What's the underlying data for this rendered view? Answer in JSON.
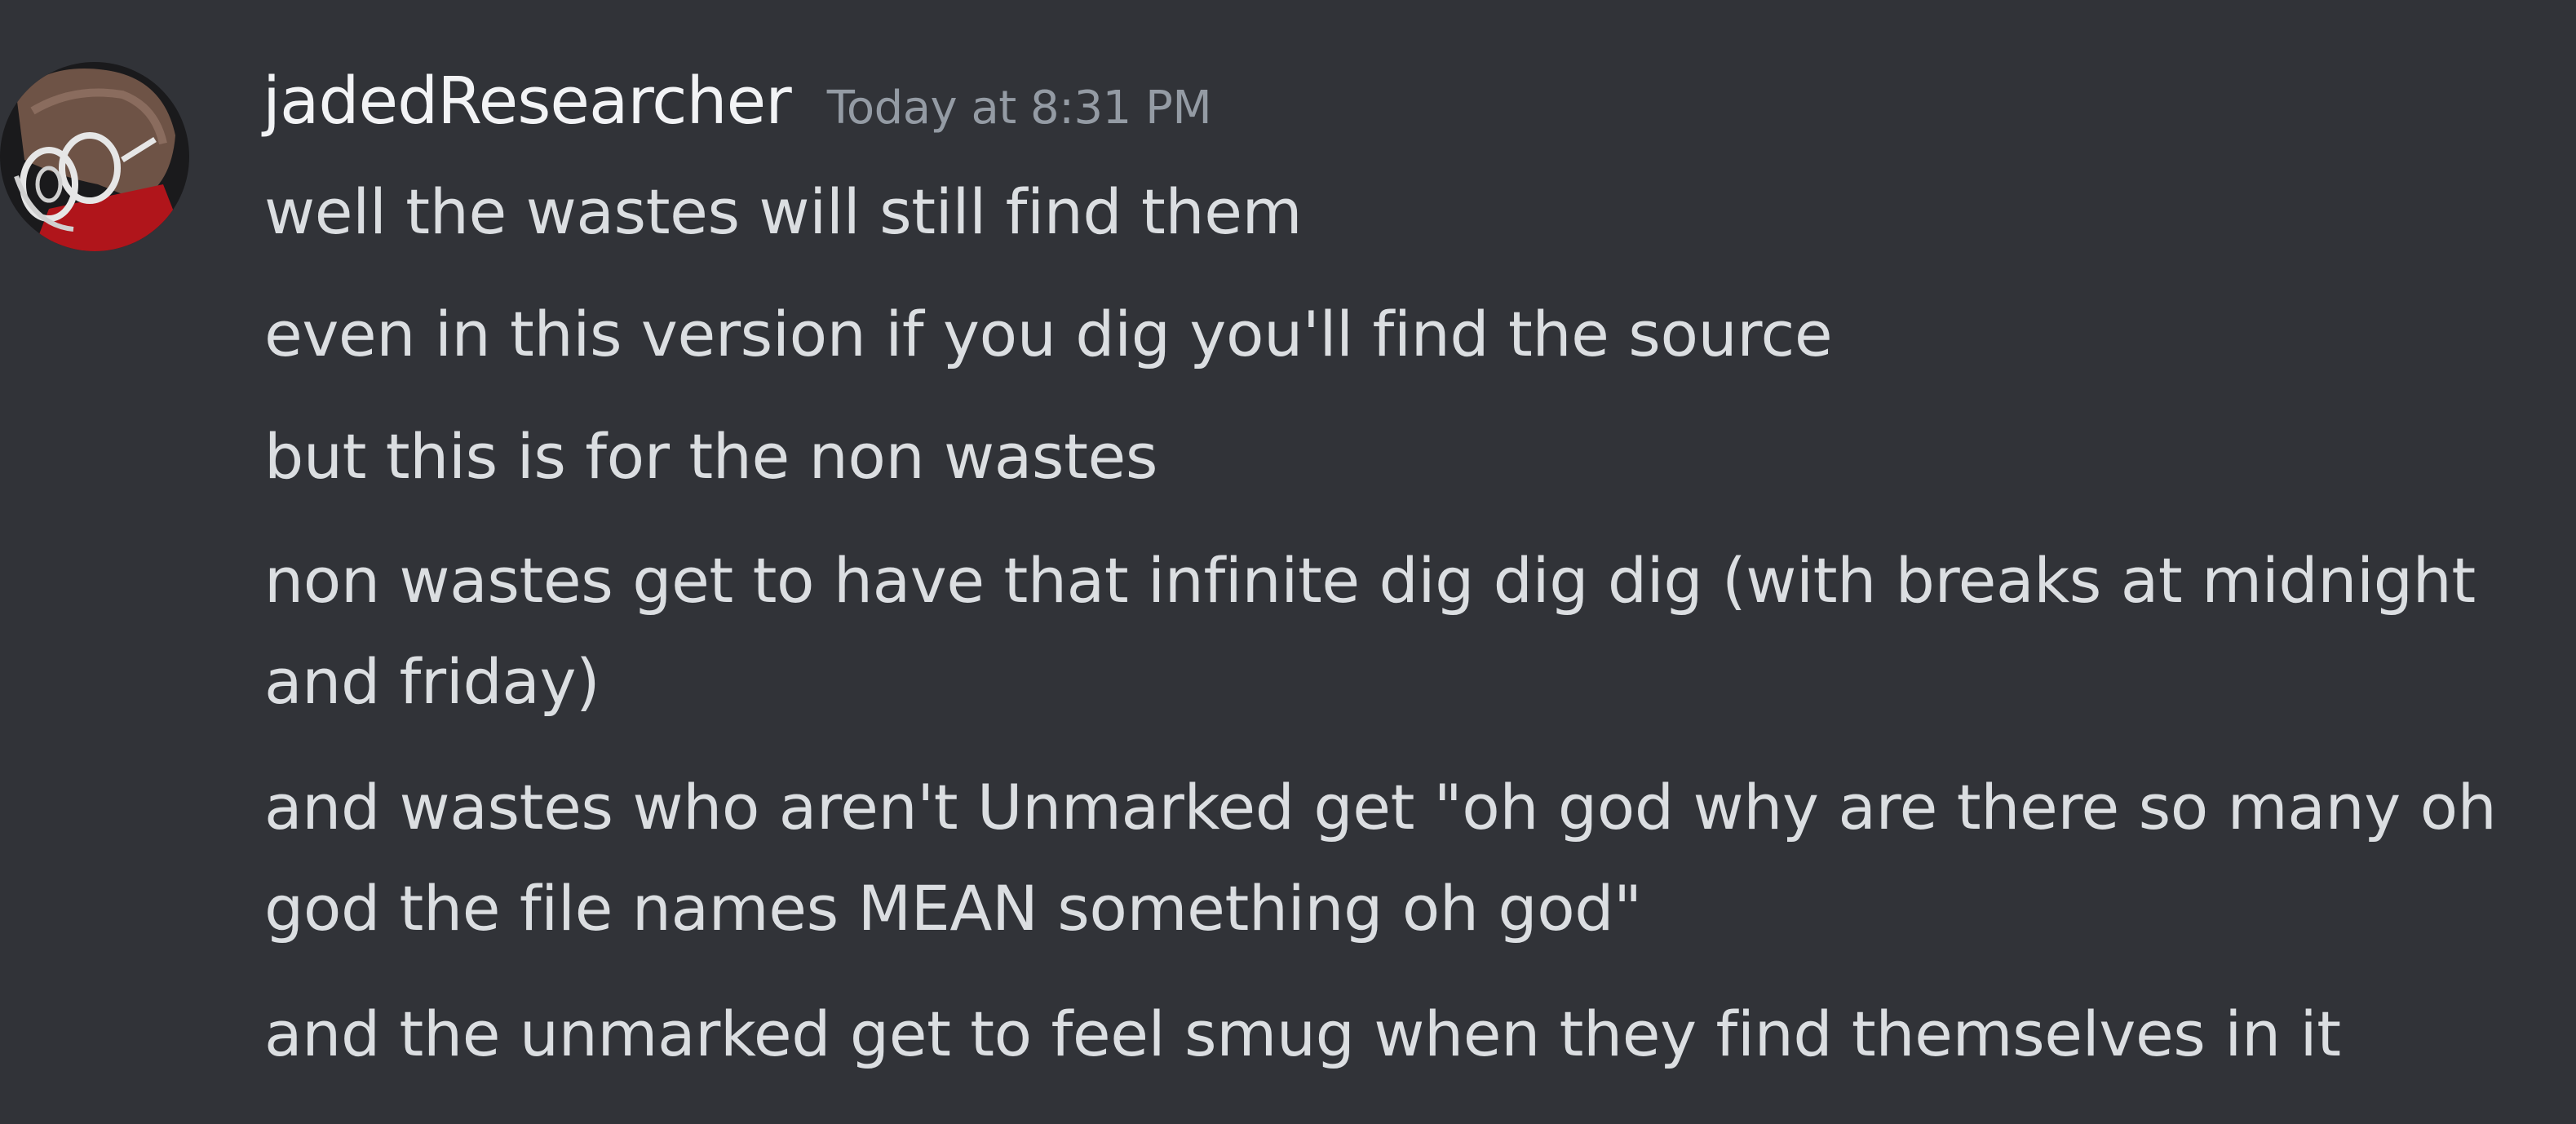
{
  "message": {
    "author": "jadedResearcher",
    "timestamp": "Today at 8:31 PM",
    "avatar_icon": "avatar-icon",
    "lines": [
      "well the wastes will still find them",
      "even in this version if you dig you'll find the source",
      "but this is for the non wastes",
      "non wastes get to have that infinite dig dig dig (with breaks at midnight",
      "and friday)",
      "and wastes who aren't Unmarked get \"oh god why are there so many oh",
      "god the file names MEAN something oh god\"",
      "and the unmarked get to feel smug when they find themselves in it"
    ]
  },
  "colors": {
    "background": "#313338",
    "username": "#f2f3f5",
    "timestamp": "#949ba4",
    "text": "#dbdee1"
  }
}
